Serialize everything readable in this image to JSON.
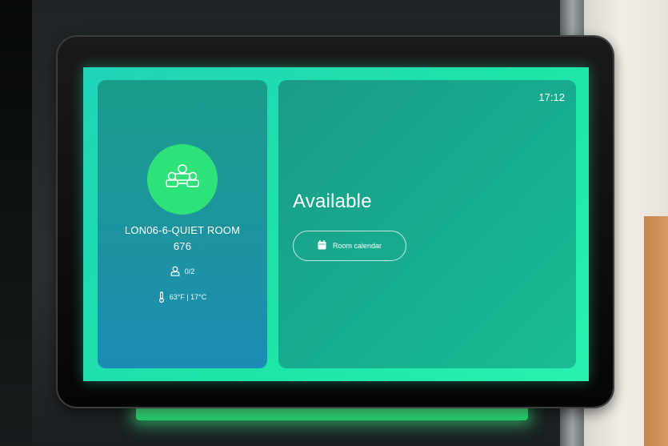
{
  "room": {
    "name_line1": "LON06-6-QUIET ROOM",
    "name_line2": "676",
    "capacity": "0/2",
    "temperature": "63°F | 17°C"
  },
  "status": {
    "clock": "17:12",
    "availability": "Available",
    "calendar_button_label": "Room calendar"
  },
  "icons": {
    "room": "people-group-icon",
    "capacity": "person-icon",
    "temperature": "thermometer-icon",
    "calendar": "calendar-icon"
  },
  "colors": {
    "screen_accent": "#1ee6a6",
    "avatar": "#2ee27a",
    "glow": "#3aff8c"
  }
}
